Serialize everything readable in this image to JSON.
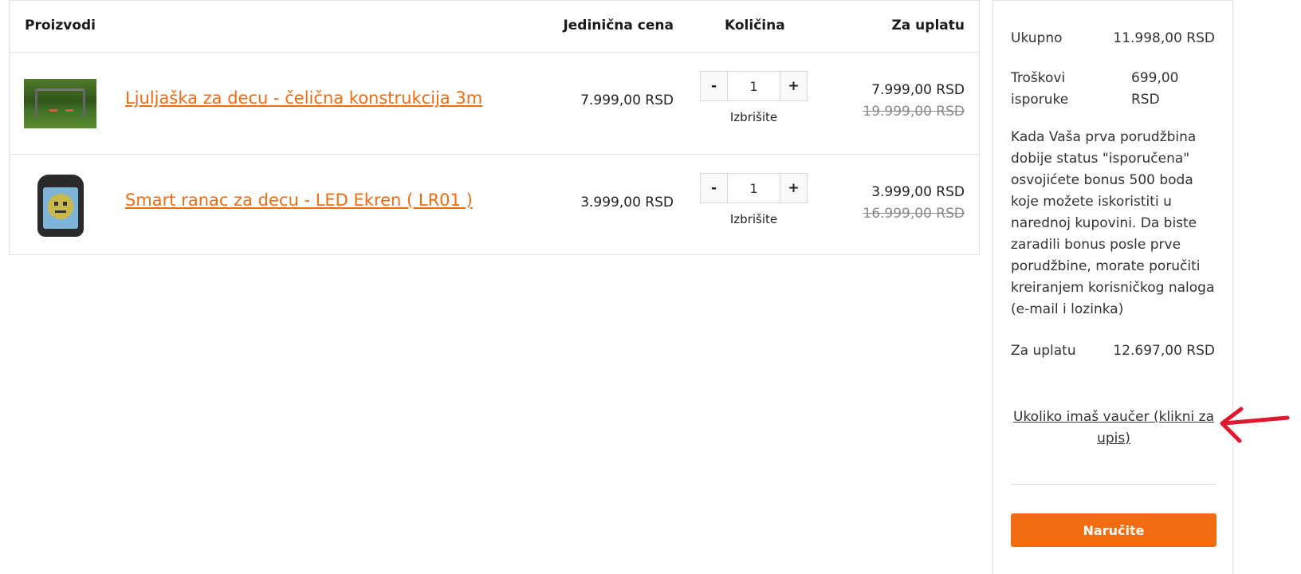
{
  "table": {
    "headers": {
      "products": "Proizvodi",
      "unit_price": "Jedinična cena",
      "quantity": "Količina",
      "to_pay": "Za uplatu"
    },
    "items": [
      {
        "name": "Ljuljaška za decu - čelična konstrukcija 3m",
        "unit_price": "7.999,00  RSD",
        "quantity": "1",
        "remove_label": "Izbrišite",
        "price_now": "7.999,00  RSD",
        "price_old": "19.999,00  RSD",
        "image": "swing-set-image"
      },
      {
        "name": "Smart ranac za decu - LED Ekren ( LR01 )",
        "unit_price": "3.999,00  RSD",
        "quantity": "1",
        "remove_label": "Izbrišite",
        "price_now": "3.999,00  RSD",
        "price_old": "16.999,00  RSD",
        "image": "led-backpack-image"
      }
    ],
    "minus_label": "-",
    "plus_label": "+"
  },
  "summary": {
    "total_label": "Ukupno",
    "total_value": "11.998,00  RSD",
    "shipping_label": "Troškovi isporuke",
    "shipping_value": "699,00 RSD",
    "info_text": "Kada Vaša prva porudžbina dobije status \"isporučena\" osvojićete bonus 500 boda koje možete iskoristiti u narednoj kupovini. Da biste zaradili bonus posle prve porudžbine, morate poručiti kreiranjem korisničkog naloga (e-mail i lozinka)",
    "pay_label": "Za uplatu",
    "pay_value": "12.697,00  RSD",
    "voucher_link": "Ukoliko imaš vaučer (klikni za upis)",
    "order_button": "Naručite"
  },
  "colors": {
    "accent": "#f26b0f",
    "annotation_arrow": "#e0182d"
  }
}
